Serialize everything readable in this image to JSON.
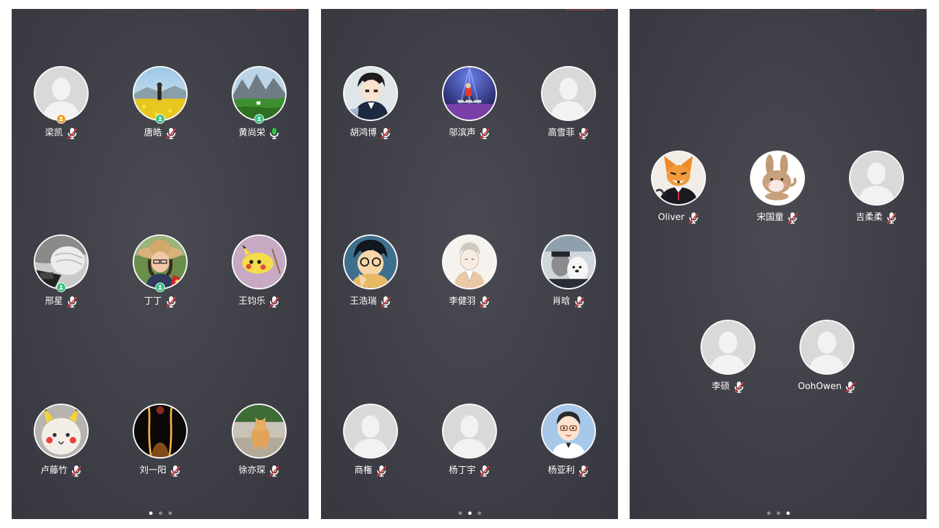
{
  "colors": {
    "mic_muted": "#e0383e",
    "mic_active": "#27c43f",
    "badge_host": "#f39c1f",
    "badge_member": "#2ec27e",
    "placeholder_bg": "#d9d9d9",
    "placeholder_person": "#f2f2f2"
  },
  "panels": [
    {
      "active_page": 0,
      "page_count": 3,
      "members": [
        {
          "name": "梁凯",
          "mic": "muted",
          "badge": "host",
          "avatar": "default-avatar"
        },
        {
          "name": "唐皓",
          "mic": "muted",
          "badge": "member",
          "avatar": "photo-flower-field"
        },
        {
          "name": "黄尚栄",
          "mic": "active",
          "badge": "member",
          "avatar": "photo-mountain-valley"
        },
        {
          "name": "邢星",
          "mic": "muted",
          "badge": "member",
          "avatar": "photo-bw-knit-hat"
        },
        {
          "name": "丁丁",
          "mic": "muted",
          "badge": "member",
          "avatar": "photo-woman-sunhat"
        },
        {
          "name": "王钧乐",
          "mic": "muted",
          "badge": null,
          "avatar": "photo-pikachu-plush"
        },
        {
          "name": "卢藤竹",
          "mic": "muted",
          "badge": null,
          "avatar": "photo-cat-pikachu-ears"
        },
        {
          "name": "刘一阳",
          "mic": "muted",
          "badge": null,
          "avatar": "photo-backlit-silhouette"
        },
        {
          "name": "徐亦琛",
          "mic": "muted",
          "badge": null,
          "avatar": "photo-orange-cat"
        }
      ]
    },
    {
      "active_page": 1,
      "page_count": 3,
      "members": [
        {
          "name": "胡鸿博",
          "mic": "muted",
          "badge": null,
          "avatar": "anime-boy"
        },
        {
          "name": "邬滨声",
          "mic": "muted",
          "badge": null,
          "avatar": "photo-stage-performer"
        },
        {
          "name": "高雪菲",
          "mic": "muted",
          "badge": null,
          "avatar": "default-avatar"
        },
        {
          "name": "王浩瑞",
          "mic": "muted",
          "badge": null,
          "avatar": "anime-glasses-boy"
        },
        {
          "name": "李健羽",
          "mic": "muted",
          "badge": null,
          "avatar": "sketch-boy"
        },
        {
          "name": "肖晗",
          "mic": "muted",
          "badge": null,
          "avatar": "cartoon-bears"
        },
        {
          "name": "商権",
          "mic": "muted",
          "badge": null,
          "avatar": "default-avatar"
        },
        {
          "name": "杨丁宇",
          "mic": "muted",
          "badge": null,
          "avatar": "default-avatar"
        },
        {
          "name": "杨亚利",
          "mic": "muted",
          "badge": null,
          "avatar": "cartoon-glasses-man"
        }
      ]
    },
    {
      "active_page": 2,
      "page_count": 3,
      "members": [
        {
          "name": "Oliver",
          "mic": "muted",
          "badge": null,
          "avatar": "anime-fox-boy"
        },
        {
          "name": "宋国童",
          "mic": "muted",
          "badge": null,
          "avatar": "cartoon-rabbit"
        },
        {
          "name": "吉柔柔",
          "mic": "muted",
          "badge": null,
          "avatar": "default-avatar"
        },
        {
          "name": "李硕",
          "mic": "muted",
          "badge": null,
          "avatar": "default-avatar"
        },
        {
          "name": "OohOwen",
          "mic": "muted",
          "badge": null,
          "avatar": "default-avatar"
        }
      ]
    }
  ]
}
